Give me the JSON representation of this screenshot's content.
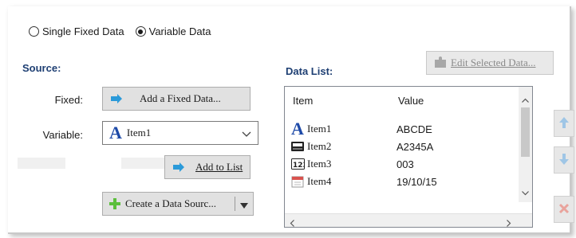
{
  "mode": {
    "options": [
      {
        "label": "Single Fixed Data",
        "selected": false
      },
      {
        "label": "Variable Data",
        "selected": true
      }
    ]
  },
  "source": {
    "title": "Source:",
    "fixed_label": "Fixed:",
    "add_fixed_button": "Add a Fixed Data...",
    "variable_label": "Variable:",
    "variable_value": "Item1",
    "add_to_list_button": "Add to List",
    "create_source_button": "Create a Data Sourc..."
  },
  "data_list": {
    "title": "Data List:",
    "edit_button": "Edit Selected Data...",
    "col_item": "Item",
    "col_value": "Value",
    "rows": [
      {
        "item": "Item1",
        "value": "ABCDE",
        "icon": "text-a-icon"
      },
      {
        "item": "Item2",
        "value": "A2345A",
        "icon": "counter-icon"
      },
      {
        "item": "Item3",
        "value": "003",
        "icon": "number-icon"
      },
      {
        "item": "Item4",
        "value": "19/10/15",
        "icon": "calendar-icon"
      }
    ]
  },
  "colors": {
    "accent": "#1e3f73",
    "arrow_blue": "#2b9ad9",
    "plus_green": "#5bbf3b"
  }
}
